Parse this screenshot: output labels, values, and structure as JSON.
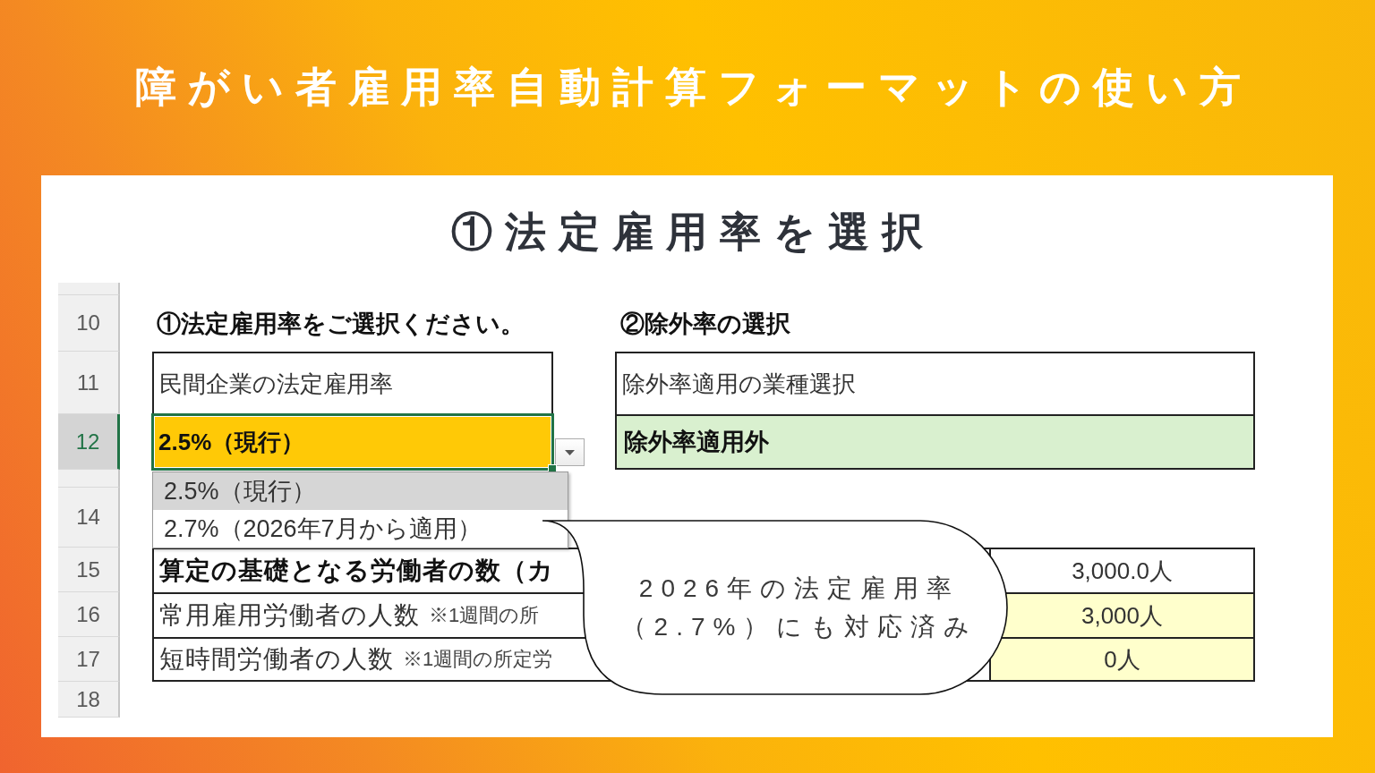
{
  "title": "障がい者雇用率自動計算フォーマットの使い方",
  "panel": {
    "heading": "①法定雇用率を選択",
    "spreadsheet": {
      "row_headers": [
        {
          "kind": "blank"
        },
        {
          "kind": "number",
          "label": "10",
          "selected": false
        },
        {
          "kind": "number",
          "label": "11",
          "selected": false
        },
        {
          "kind": "number",
          "label": "12",
          "selected": true
        },
        {
          "kind": "blank"
        },
        {
          "kind": "number",
          "label": "14",
          "selected": false
        },
        {
          "kind": "number",
          "label": "15",
          "selected": false
        },
        {
          "kind": "number",
          "label": "16",
          "selected": false
        },
        {
          "kind": "number",
          "label": "17",
          "selected": false
        },
        {
          "kind": "number",
          "label": "18",
          "selected": false
        }
      ],
      "rate_section": {
        "heading": "①法定雇用率をご選択ください。",
        "label_cell": "民間企業の法定雇用率",
        "value_cell": {
          "value": "2.5%（現行）",
          "selected": true
        },
        "dropdown": {
          "expanded": true,
          "options": [
            {
              "label": "2.5%（現行）",
              "selected": true
            },
            {
              "label": "2.7%（2026年7月から適用）",
              "selected": false
            }
          ]
        }
      },
      "exclusion_section": {
        "heading": "②除外率の選択",
        "label_cell": "除外率適用の業種選択",
        "value_cell": "除外率適用外"
      },
      "worker_table": {
        "rows": [
          {
            "kind": "total",
            "label": "算定の基礎となる労働者の数（カ",
            "value": "3,000.0人"
          },
          {
            "kind": "input",
            "label": "常用雇用労働者の人数",
            "note": "※1週間の所",
            "value": "3,000人"
          },
          {
            "kind": "input",
            "label": "短時間労働者の人数",
            "note": "※1週間の所定労",
            "value": "0人"
          }
        ]
      }
    },
    "callout": {
      "lines": [
        "2026年の法定雇用率",
        "（2.7%）にも対応済み"
      ]
    }
  }
}
